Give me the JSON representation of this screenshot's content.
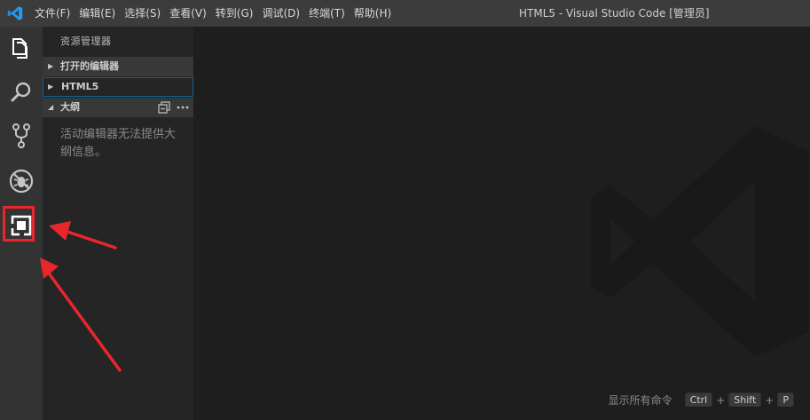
{
  "titlebar": {
    "menu": [
      "文件(F)",
      "编辑(E)",
      "选择(S)",
      "查看(V)",
      "转到(G)",
      "调试(D)",
      "终端(T)",
      "帮助(H)"
    ],
    "window_title": "HTML5 - Visual Studio Code [管理员]"
  },
  "activitybar": {
    "icons": [
      "explorer-icon",
      "search-icon",
      "source-control-icon",
      "debug-icon",
      "extensions-icon"
    ],
    "highlighted": "extensions-icon"
  },
  "sidebar": {
    "title": "资源管理器",
    "sections": {
      "open_editors": "打开的编辑器",
      "folder": "HTML5",
      "outline": "大纲"
    },
    "outline_message": "活动编辑器无法提供大纲信息。"
  },
  "editor": {
    "shortcut_label": "显示所有命令",
    "keys": [
      "Ctrl",
      "Shift",
      "P"
    ],
    "key_separator": "+"
  },
  "colors": {
    "accent": "#0e639c",
    "annotation": "#e8262b",
    "logo_blue": "#1f9cf0"
  }
}
